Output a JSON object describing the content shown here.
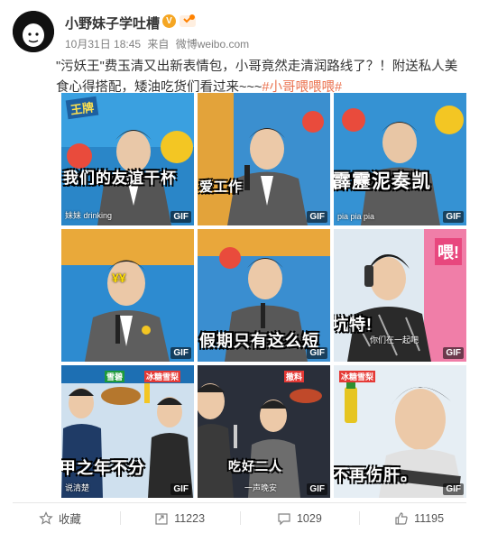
{
  "post": {
    "username": "小野妹子学吐槽",
    "verified_badge": "V",
    "date": "10月31日 18:45",
    "source_prefix": "来自",
    "source": "微博weibo.com",
    "text": "\"污妖王\"费玉清又出新表情包，小哥竟然走清润路线了？！附送私人美食心得搭配，矮油吃货们看过来~~~",
    "hashtag": "#小哥喂喂喂#"
  },
  "tiles": [
    {
      "subtitle": "我们的友谊干杯",
      "caption": "妹妹 drinking",
      "banner": "王牌",
      "gif": "GIF"
    },
    {
      "subtitle": "爱工作",
      "caption": "",
      "gif": "GIF"
    },
    {
      "subtitle": "霹靂泥奏凯",
      "caption": "pia pia pia",
      "gif": "GIF"
    },
    {
      "subtitle": "",
      "caption": "",
      "overlay": "¥¥",
      "gif": "GIF"
    },
    {
      "subtitle": "假期只有这么短",
      "caption": "",
      "gif": "GIF"
    },
    {
      "subtitle": "坑特!",
      "caption": "你们在一起吧",
      "banner": "喂!",
      "gif": "GIF"
    },
    {
      "subtitle": "甲之年不分",
      "caption": "说清楚",
      "label1": "雪碧",
      "label2": "冰糖雪梨",
      "gif": "GIF"
    },
    {
      "subtitle": "吃好二人",
      "caption": "一声晚安",
      "label1": "撒料",
      "gif": "GIF"
    },
    {
      "subtitle": "不再伤肝。",
      "caption": "",
      "label1": "冰糖雪梨",
      "gif": "GIF"
    }
  ],
  "actions": {
    "favorite_label": "收藏",
    "repost_count": "11223",
    "comment_count": "1029",
    "like_count": "11195"
  },
  "colors": {
    "hashtag": "#eb7350",
    "meta": "#808080",
    "vbadge": "#f5a623"
  }
}
